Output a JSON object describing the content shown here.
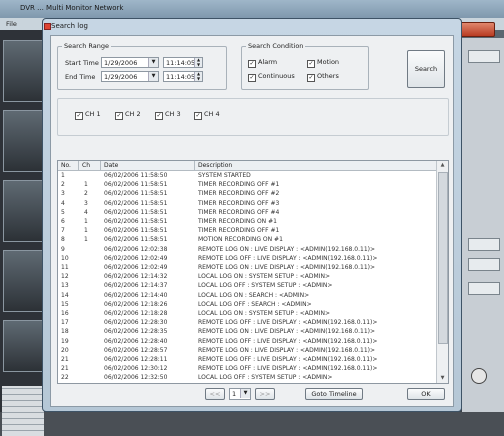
{
  "background": {
    "title": "DVR ... Multi Monitor Network",
    "menu": "File"
  },
  "dialog": {
    "title": "Search log",
    "search_range": {
      "legend": "Search Range",
      "start_label": "Start Time",
      "start_date": "1/29/2006",
      "start_time": "11:14:05",
      "end_label": "End Time",
      "end_date": "1/29/2006",
      "end_time": "11:14:05"
    },
    "search_condition": {
      "legend": "Search Condition",
      "alarm": "Alarm",
      "motion": "Motion",
      "continuous": "Continuous",
      "others": "Others"
    },
    "search_button": "Search",
    "channels": [
      "CH 1",
      "CH 2",
      "CH 3",
      "CH 4"
    ],
    "table": {
      "headers": {
        "no": "No.",
        "ch": "Ch",
        "date": "Date",
        "desc": "Description"
      },
      "rows": [
        {
          "no": "1",
          "ch": "",
          "date": "06/02/2006 11:58:50",
          "desc": "SYSTEM STARTED"
        },
        {
          "no": "2",
          "ch": "1",
          "date": "06/02/2006 11:58:51",
          "desc": "TIMER RECORDING OFF  #1"
        },
        {
          "no": "3",
          "ch": "2",
          "date": "06/02/2006 11:58:51",
          "desc": "TIMER RECORDING OFF  #2"
        },
        {
          "no": "4",
          "ch": "3",
          "date": "06/02/2006 11:58:51",
          "desc": "TIMER RECORDING OFF  #3"
        },
        {
          "no": "5",
          "ch": "4",
          "date": "06/02/2006 11:58:51",
          "desc": "TIMER RECORDING OFF  #4"
        },
        {
          "no": "6",
          "ch": "1",
          "date": "06/02/2006 11:58:51",
          "desc": "TIMER RECORDING ON  #1"
        },
        {
          "no": "7",
          "ch": "1",
          "date": "06/02/2006 11:58:51",
          "desc": "TIMER RECORDING OFF  #1"
        },
        {
          "no": "8",
          "ch": "1",
          "date": "06/02/2006 11:58:51",
          "desc": "MOTION RECORDING ON  #1"
        },
        {
          "no": "9",
          "ch": "",
          "date": "06/02/2006 12:02:38",
          "desc": "REMOTE LOG ON : LIVE DISPLAY : <ADMIN(192.168.0.11)>"
        },
        {
          "no": "10",
          "ch": "",
          "date": "06/02/2006 12:02:49",
          "desc": "REMOTE LOG OFF : LIVE DISPLAY : <ADMIN(192.168.0.11)>"
        },
        {
          "no": "11",
          "ch": "",
          "date": "06/02/2006 12:02:49",
          "desc": "REMOTE LOG ON : LIVE DISPLAY : <ADMIN(192.168.0.11)>"
        },
        {
          "no": "12",
          "ch": "",
          "date": "06/02/2006 12:14:32",
          "desc": "LOCAL LOG ON : SYSTEM SETUP : <ADMIN>"
        },
        {
          "no": "13",
          "ch": "",
          "date": "06/02/2006 12:14:37",
          "desc": "LOCAL LOG OFF : SYSTEM SETUP : <ADMIN>"
        },
        {
          "no": "14",
          "ch": "",
          "date": "06/02/2006 12:14:40",
          "desc": "LOCAL LOG ON : SEARCH : <ADMIN>"
        },
        {
          "no": "15",
          "ch": "",
          "date": "06/02/2006 12:18:26",
          "desc": "LOCAL LOG OFF : SEARCH : <ADMIN>"
        },
        {
          "no": "16",
          "ch": "",
          "date": "06/02/2006 12:18:28",
          "desc": "LOCAL LOG ON : SYSTEM SETUP : <ADMIN>"
        },
        {
          "no": "17",
          "ch": "",
          "date": "06/02/2006 12:28:30",
          "desc": "REMOTE LOG OFF : LIVE DISPLAY : <ADMIN(192.168.0.11)>"
        },
        {
          "no": "18",
          "ch": "",
          "date": "06/02/2006 12:28:35",
          "desc": "REMOTE LOG ON : LIVE DISPLAY : <ADMIN(192.168.0.11)>"
        },
        {
          "no": "19",
          "ch": "",
          "date": "06/02/2006 12:28:40",
          "desc": "REMOTE LOG OFF : LIVE DISPLAY : <ADMIN(192.168.0.11)>"
        },
        {
          "no": "20",
          "ch": "",
          "date": "06/02/2006 12:28:57",
          "desc": "REMOTE LOG ON : LIVE DISPLAY : <ADMIN(192.168.0.11)>"
        },
        {
          "no": "21",
          "ch": "",
          "date": "06/02/2006 12:28:11",
          "desc": "REMOTE LOG OFF : LIVE DISPLAY : <ADMIN(192.168.0.11)>"
        },
        {
          "no": "21",
          "ch": "",
          "date": "06/02/2006 12:30:12",
          "desc": "REMOTE LOG OFF : LIVE DISPLAY : <ADMIN(192.168.0.11)>"
        },
        {
          "no": "22",
          "ch": "",
          "date": "06/02/2006 12:32:50",
          "desc": "LOCAL LOG OFF : SYSTEM SETUP : <ADMIN>"
        }
      ]
    },
    "pager": {
      "prev": "<<",
      "page": "1",
      "next": ">>"
    },
    "goto_timeline": "Goto Timeline",
    "ok": "OK"
  }
}
